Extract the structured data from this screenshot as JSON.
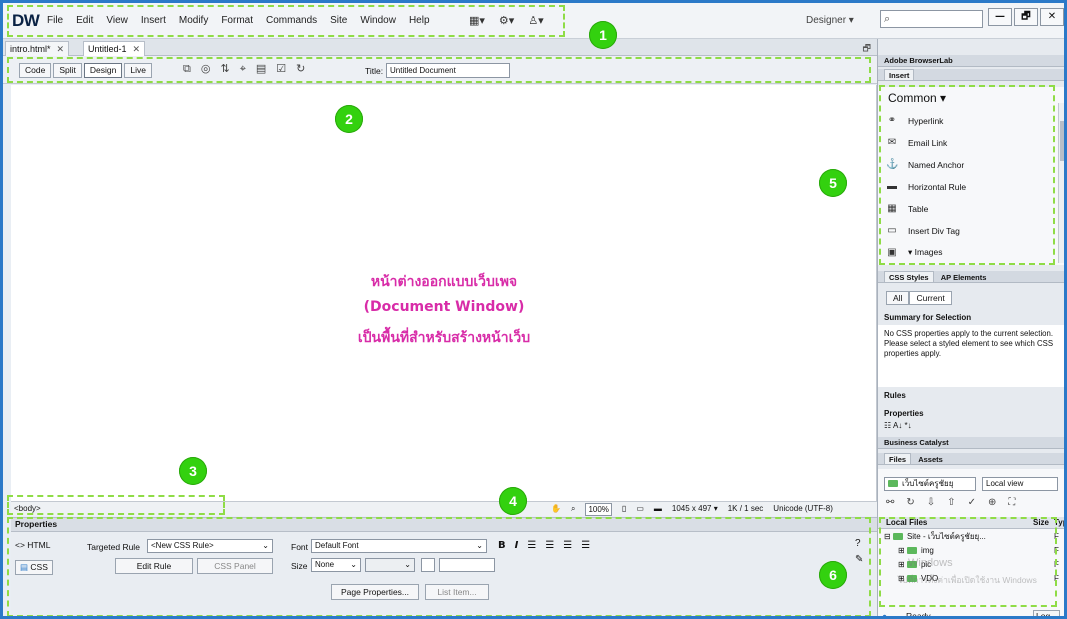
{
  "app": {
    "logo": "DW",
    "menus": [
      "File",
      "Edit",
      "View",
      "Insert",
      "Modify",
      "Format",
      "Commands",
      "Site",
      "Window",
      "Help"
    ],
    "workspace": "Designer ▾",
    "window_buttons": [
      "—",
      "🗗",
      "✕"
    ]
  },
  "doc_tabs": [
    "intro.html*",
    "Untitled-1"
  ],
  "doc_toolbar": {
    "view_buttons": [
      "Code",
      "Split",
      "Design",
      "Live"
    ],
    "title_label": "Title:",
    "title_value": "Untitled Document"
  },
  "canvas": {
    "line1": "หน้าต่างออกแบบเว็บเพจ",
    "line2": "(Document Window)",
    "line3": "เป็นพื้นที่สำหรับสร้างหน้าเว็บ"
  },
  "status_bar": {
    "tag": "<body>",
    "zoom": "100%",
    "dimensions": "1045 x 497 ▾",
    "size_time": "1K / 1 sec",
    "encoding": "Unicode (UTF-8)"
  },
  "properties": {
    "header": "Properties",
    "html_label": "<> HTML",
    "css_label": "CSS",
    "targeted_rule_label": "Targeted Rule",
    "targeted_rule_value": "<New CSS Rule>",
    "edit_rule": "Edit Rule",
    "css_panel": "CSS Panel",
    "font_label": "Font",
    "font_value": "Default Font",
    "size_label": "Size",
    "size_value": "None",
    "page_properties": "Page Properties...",
    "list_item": "List Item..."
  },
  "right_panel": {
    "browserlab": "Adobe BrowserLab",
    "insert_tab": "Insert",
    "common": "Common ▾",
    "insert_items": [
      {
        "icon": "⚭",
        "label": "Hyperlink"
      },
      {
        "icon": "✉",
        "label": "Email Link"
      },
      {
        "icon": "⚓",
        "label": "Named Anchor"
      },
      {
        "icon": "▬",
        "label": "Horizontal Rule"
      },
      {
        "icon": "▦",
        "label": "Table"
      },
      {
        "icon": "▭",
        "label": "Insert Div Tag"
      },
      {
        "icon": "▣",
        "label": "▾ Images"
      }
    ],
    "css_tabs": [
      "CSS Styles",
      "AP Elements"
    ],
    "css_buttons": [
      "All",
      "Current"
    ],
    "summary_title": "Summary for Selection",
    "summary_text": "No CSS properties apply to the current selection. Please select a styled element to see which CSS properties apply.",
    "rules": "Rules",
    "properties": "Properties",
    "business_catalyst": "Business Catalyst",
    "files_tabs": [
      "Files",
      "Assets"
    ],
    "site_select": "เว็บไซต์ครูชัยยุ",
    "view_select": "Local view",
    "local_files": "Local Files",
    "size_col": "Size",
    "type_col": "Typ",
    "tree": [
      {
        "name": "Site - เว็บไซต์ครูชัยยุ...",
        "size": "F"
      },
      {
        "name": "img",
        "size": "F"
      },
      {
        "name": "pic",
        "size": "F"
      },
      {
        "name": "VDO",
        "size": "F"
      }
    ],
    "ready": "Ready",
    "log_button": "Log..."
  },
  "watermark": {
    "line1": "Windows",
    "line2": "ไปที่การตั้งค่าเพื่อเปิดใช้งาน Windows"
  },
  "callouts": [
    "1",
    "2",
    "3",
    "4",
    "5",
    "6"
  ],
  "colors": {
    "annotation_green": "#33d10f",
    "dashed_green": "#8fdc46",
    "thai_text": "#d82ca8",
    "frame_blue": "#2b79c8"
  }
}
